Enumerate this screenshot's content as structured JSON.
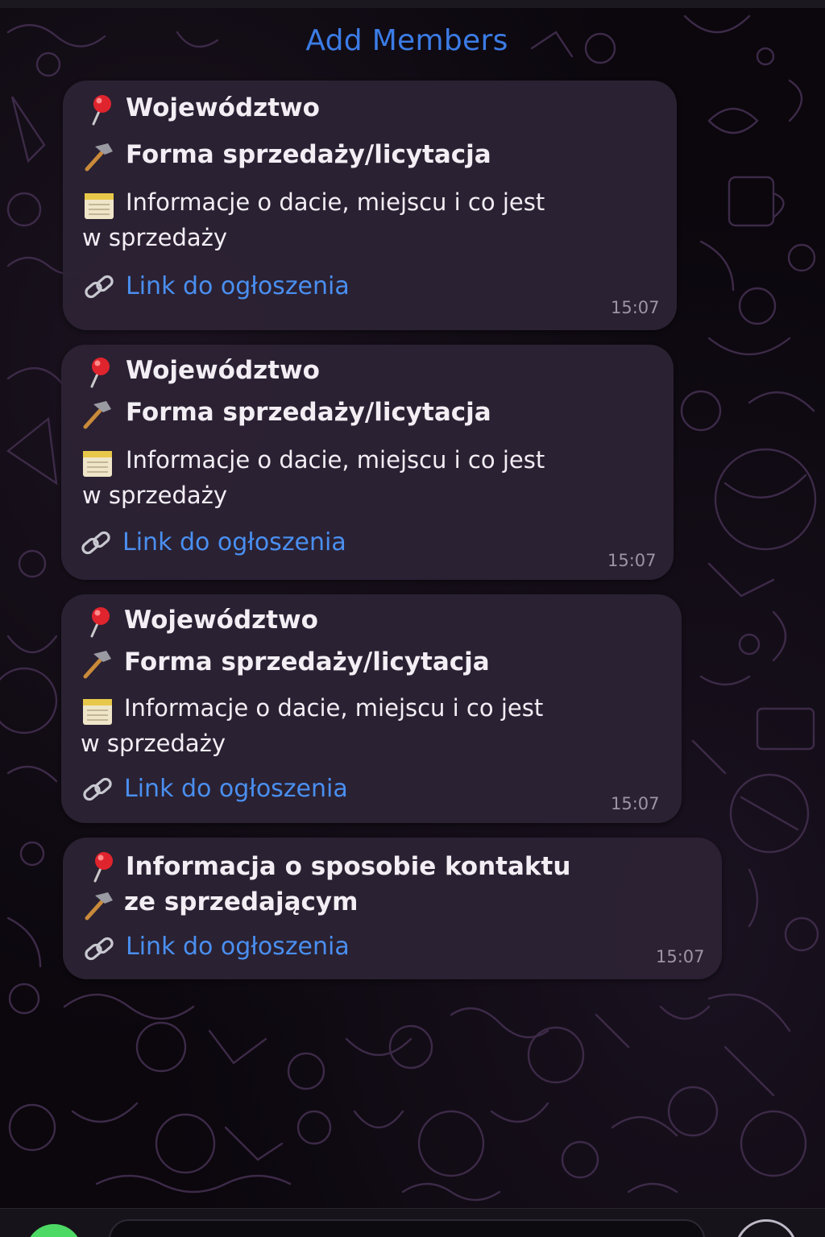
{
  "header": {
    "add_members_label": "Add Members"
  },
  "messages": [
    {
      "lines": [
        {
          "icon": "round-pushpin-icon",
          "text": "Województwo",
          "style": "bold"
        },
        {
          "icon": "hammer-icon",
          "text": "Forma sprzedaży/licytacja",
          "style": "bold"
        },
        {
          "icon": "calendar-icon",
          "text": "Informacje o dacie, miejscu i co jest",
          "style": "regular"
        },
        {
          "icon": "",
          "text": "w sprzedaży",
          "style": "regular"
        },
        {
          "icon": "link-icon",
          "text": "Link do ogłoszenia",
          "style": "link"
        }
      ],
      "time": "15:07"
    },
    {
      "lines": [
        {
          "icon": "round-pushpin-icon",
          "text": "Województwo",
          "style": "bold"
        },
        {
          "icon": "hammer-icon",
          "text": "Forma sprzedaży/licytacja",
          "style": "bold"
        },
        {
          "icon": "calendar-icon",
          "text": "Informacje o dacie, miejscu i co jest",
          "style": "regular"
        },
        {
          "icon": "",
          "text": "w sprzedaży",
          "style": "regular"
        },
        {
          "icon": "link-icon",
          "text": "Link do ogłoszenia",
          "style": "link"
        }
      ],
      "time": "15:07"
    },
    {
      "lines": [
        {
          "icon": "round-pushpin-icon",
          "text": "Województwo",
          "style": "bold"
        },
        {
          "icon": "hammer-icon",
          "text": "Forma sprzedaży/licytacja",
          "style": "bold"
        },
        {
          "icon": "calendar-icon",
          "text": "Informacje o dacie, miejscu i co jest",
          "style": "regular"
        },
        {
          "icon": "",
          "text": "w sprzedaży",
          "style": "regular"
        },
        {
          "icon": "link-icon",
          "text": "Link do ogłoszenia",
          "style": "link"
        }
      ],
      "time": "15:07"
    },
    {
      "lines": [
        {
          "icon": "round-pushpin-icon",
          "text": "Informacja o sposobie kontaktu",
          "style": "bold"
        },
        {
          "icon": "hammer-icon",
          "text": "ze sprzedającym",
          "style": "bold"
        },
        {
          "icon": "link-icon",
          "text": "Link do ogłoszenia",
          "style": "link"
        }
      ],
      "time": "15:07"
    }
  ],
  "colors": {
    "accent_blue": "#3b7ce6",
    "link_blue": "#4a8ff0",
    "bubble": "#2c2234",
    "background": "#0b070d",
    "timestamp": "#9d94a5"
  }
}
